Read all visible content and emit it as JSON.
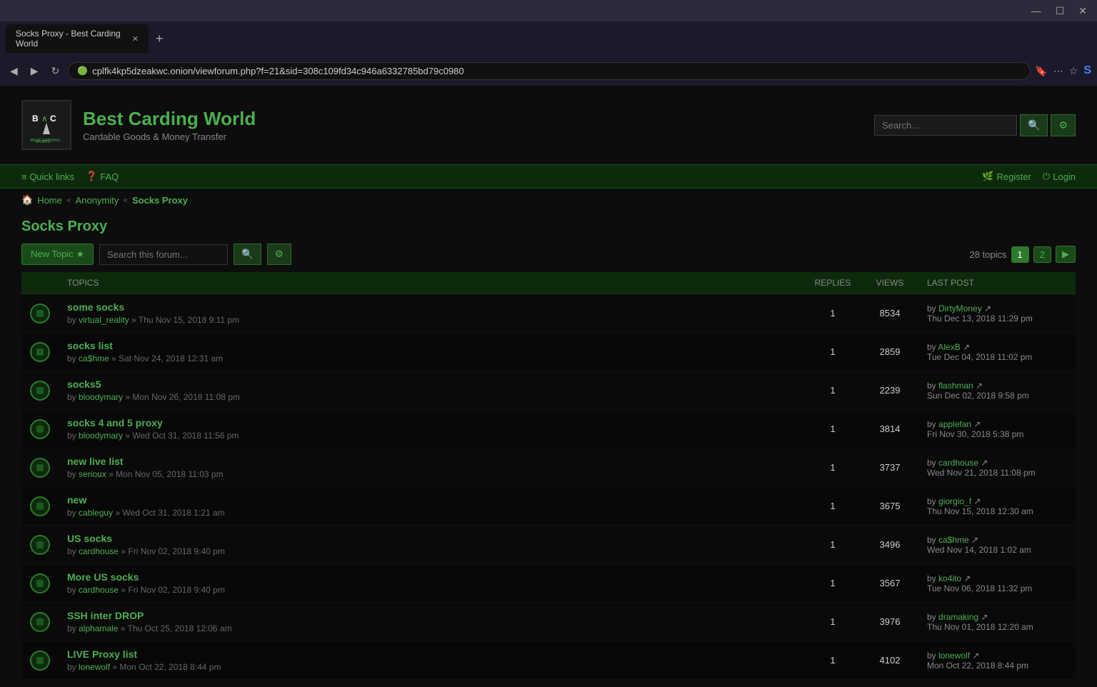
{
  "browser": {
    "tab_title": "Socks Proxy - Best Carding World",
    "url": "cplfk4kp5dzeakwc.onion/viewforum.php?f=21&sid=308c109fd34c946a6332785bd79c0980",
    "nav_back": "◀",
    "nav_forward": "▶",
    "nav_refresh": "↻",
    "new_tab": "+",
    "win_min": "—",
    "win_max": "☐",
    "win_close": "✕"
  },
  "site": {
    "title": "Best Carding World",
    "subtitle": "Cardable Goods & Money Transfer",
    "search_placeholder": "Search...",
    "search_btn": "🔍",
    "settings_btn": "⚙"
  },
  "nav": {
    "quicklinks_label": "≡ Quick links",
    "faq_label": "FAQ",
    "register_label": "Register",
    "login_label": "Login"
  },
  "breadcrumb": {
    "home": "Home",
    "anonymity": "Anonymity",
    "current": "Socks Proxy"
  },
  "forum": {
    "title": "Socks Proxy",
    "new_topic_label": "New Topic ★",
    "search_placeholder": "Search this forum...",
    "topics_count": "28 topics",
    "page1": "1",
    "page2": "2",
    "next": "▶",
    "columns": {
      "topics": "TOPICS",
      "replies": "REPLIES",
      "views": "VIEWS",
      "last_post": "LAST POST"
    },
    "topics": [
      {
        "title": "some socks",
        "author": "virtual_reality",
        "date": "Thu Nov 15, 2018 9:11 pm",
        "replies": "1",
        "views": "8534",
        "last_by": "DirtyMoney",
        "last_date": "Thu Dec 13, 2018 11:29 pm"
      },
      {
        "title": "socks list",
        "author": "ca$hme",
        "date": "Sat Nov 24, 2018 12:31 am",
        "replies": "1",
        "views": "2859",
        "last_by": "AlexB",
        "last_date": "Tue Dec 04, 2018 11:02 pm"
      },
      {
        "title": "socks5",
        "author": "bloodymary",
        "date": "Mon Nov 26, 2018 11:08 pm",
        "replies": "1",
        "views": "2239",
        "last_by": "flashman",
        "last_date": "Sun Dec 02, 2018 9:58 pm"
      },
      {
        "title": "socks 4 and 5 proxy",
        "author": "bloodymary",
        "date": "Wed Oct 31, 2018 11:56 pm",
        "replies": "1",
        "views": "3814",
        "last_by": "applefan",
        "last_date": "Fri Nov 30, 2018 5:38 pm"
      },
      {
        "title": "new live list",
        "author": "serioux",
        "date": "Mon Nov 05, 2018 11:03 pm",
        "replies": "1",
        "views": "3737",
        "last_by": "cardhouse",
        "last_date": "Wed Nov 21, 2018 11:08 pm"
      },
      {
        "title": "new",
        "author": "cableguy",
        "date": "Wed Oct 31, 2018 1:21 am",
        "replies": "1",
        "views": "3675",
        "last_by": "giorgio_f",
        "last_date": "Thu Nov 15, 2018 12:30 am"
      },
      {
        "title": "US socks",
        "author": "cardhouse",
        "date": "Fri Nov 02, 2018 9:40 pm",
        "replies": "1",
        "views": "3496",
        "last_by": "ca$hme",
        "last_date": "Wed Nov 14, 2018 1:02 am"
      },
      {
        "title": "More US socks",
        "author": "cardhouse",
        "date": "Fri Nov 02, 2018 9:40 pm",
        "replies": "1",
        "views": "3567",
        "last_by": "ko4ito",
        "last_date": "Tue Nov 06, 2018 11:32 pm"
      },
      {
        "title": "SSH inter DROP",
        "author": "alphamale",
        "date": "Thu Oct 25, 2018 12:06 am",
        "replies": "1",
        "views": "3976",
        "last_by": "dramaking",
        "last_date": "Thu Nov 01, 2018 12:20 am"
      },
      {
        "title": "LIVE Proxy list",
        "author": "lonewolf",
        "date": "Mon Oct 22, 2018 8:44 pm",
        "replies": "1",
        "views": "4102",
        "last_by": "lonewolf",
        "last_date": "Mon Oct 22, 2018 8:44 pm"
      }
    ]
  }
}
